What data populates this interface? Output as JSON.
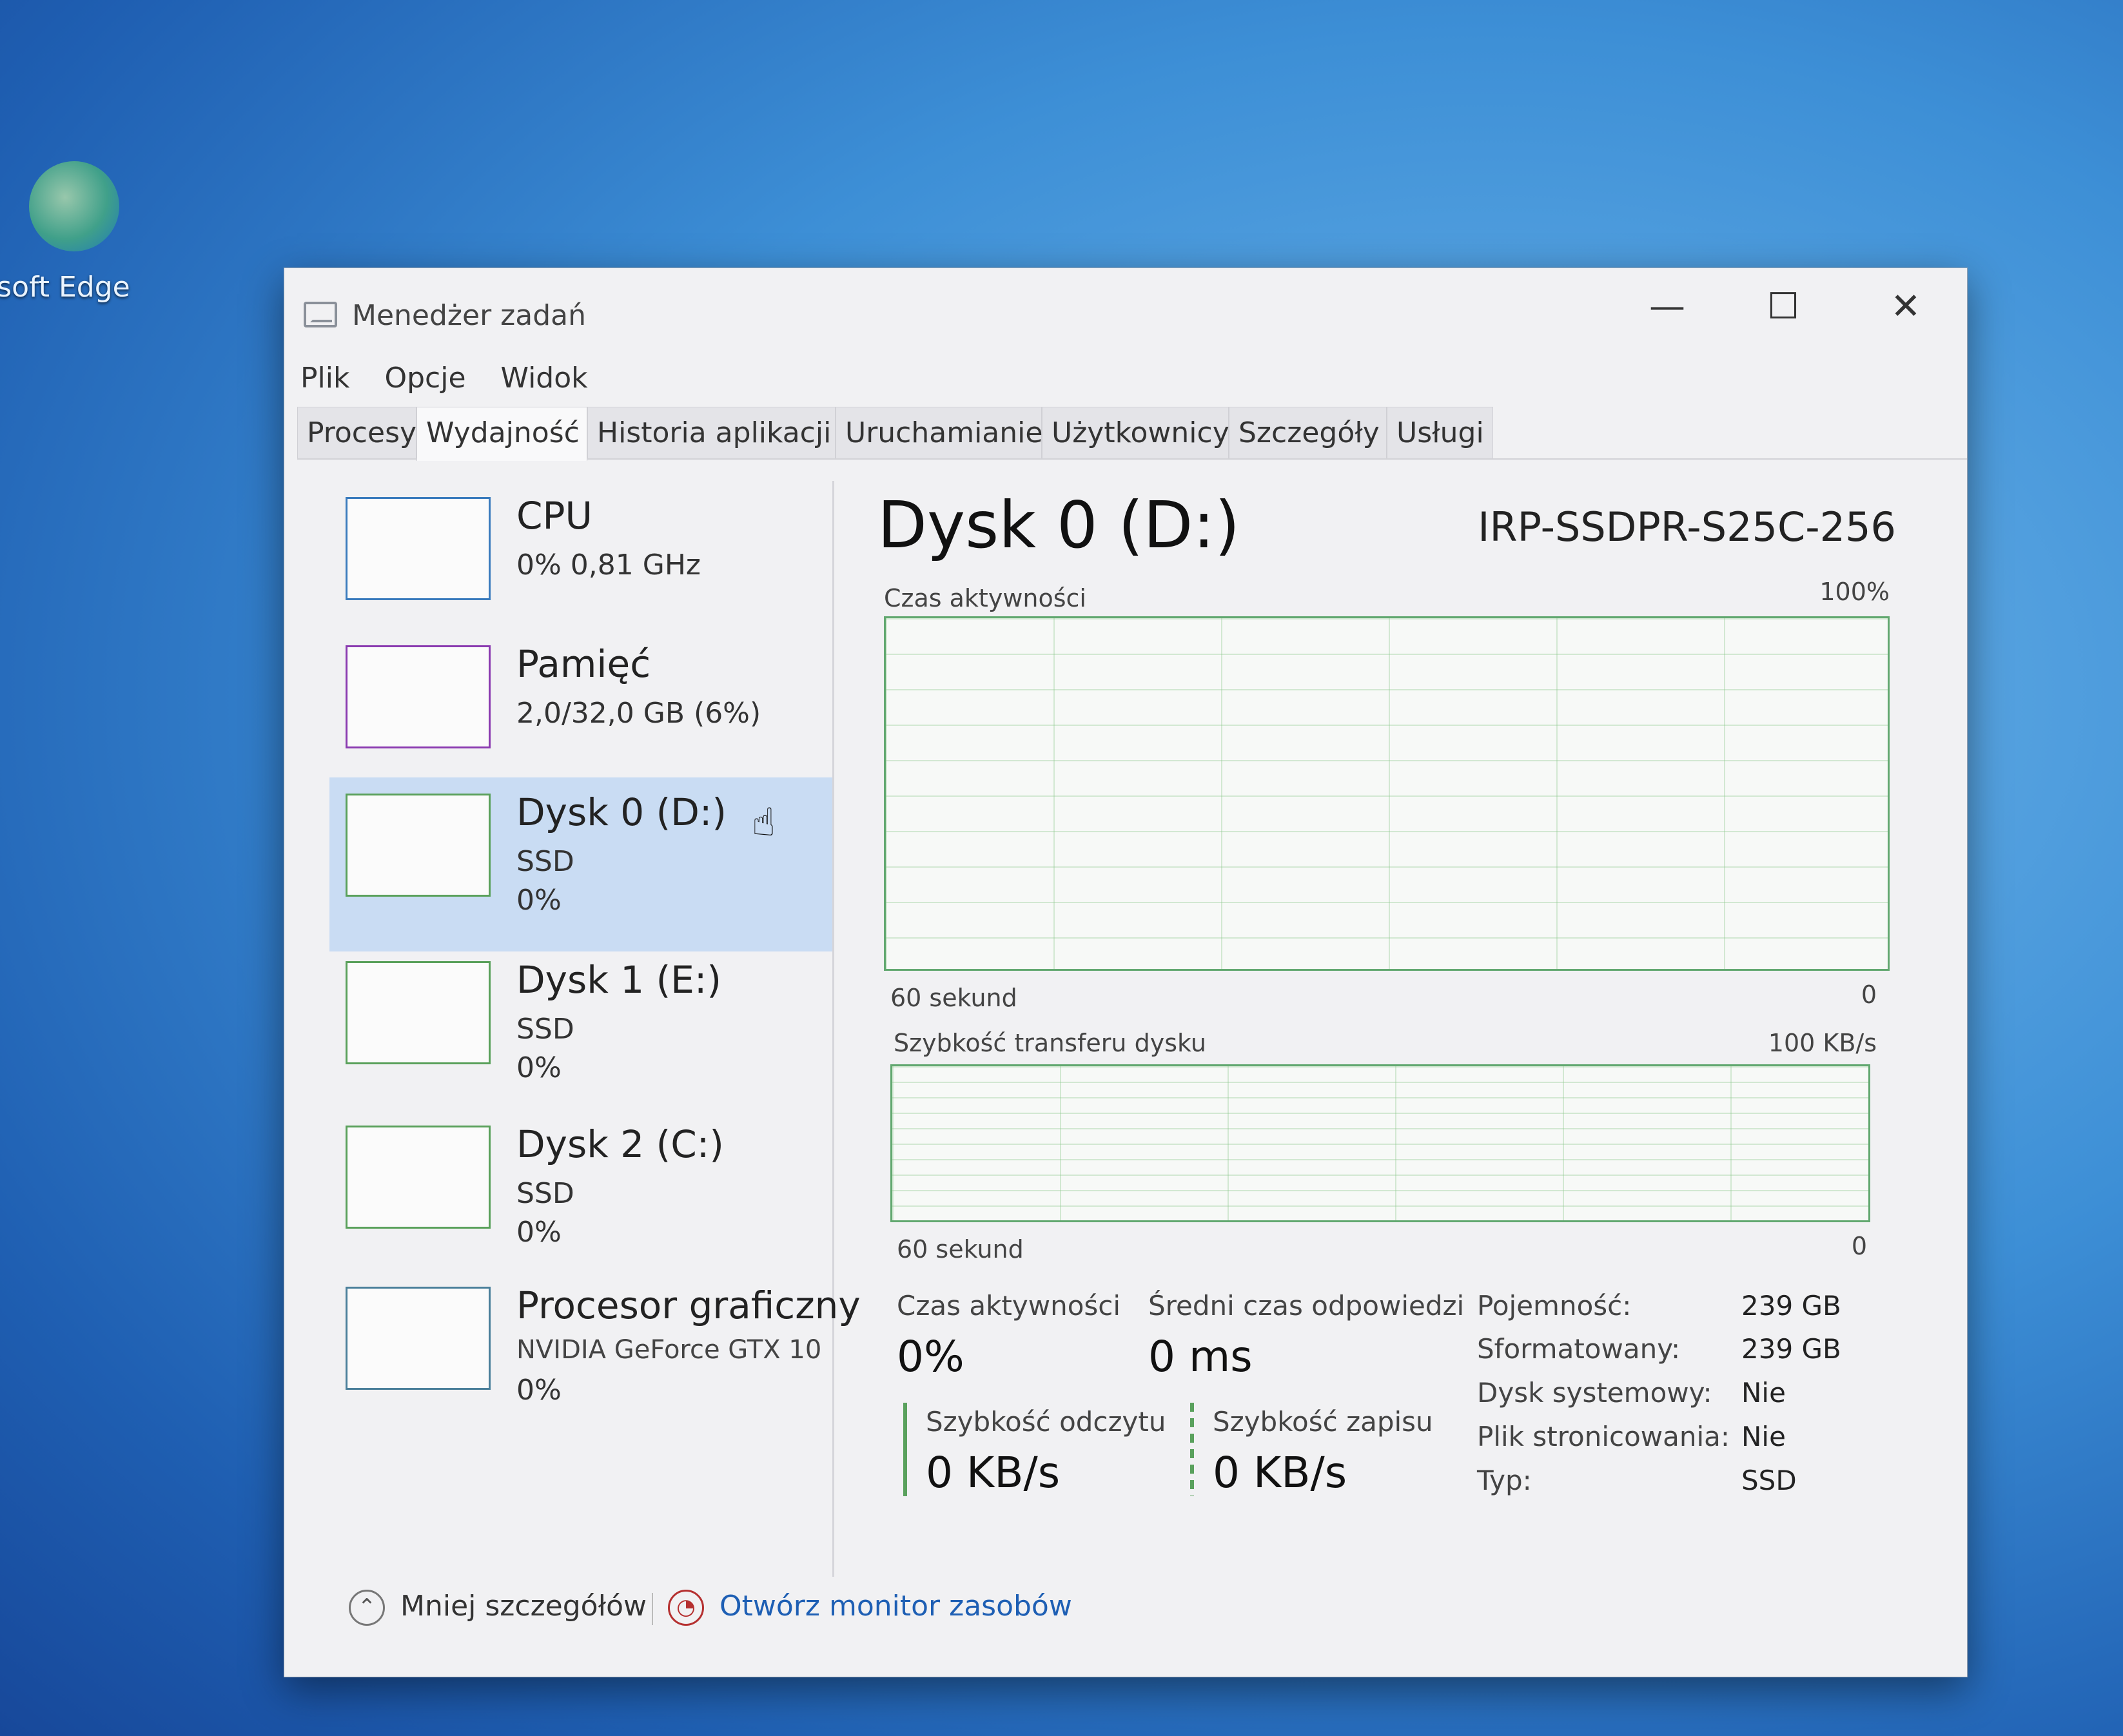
{
  "desktop": {
    "icon_label": "osoft Edge"
  },
  "window": {
    "title": "Menedżer zadań",
    "controls": {
      "minimize": "—",
      "maximize": "☐",
      "close": "✕"
    }
  },
  "menu": [
    "Plik",
    "Opcje",
    "Widok"
  ],
  "tabs": [
    "Procesy",
    "Wydajność",
    "Historia aplikacji",
    "Uruchamianie",
    "Użytkownicy",
    "Szczegóły",
    "Usługi"
  ],
  "active_tab": "Wydajność",
  "sidebar": {
    "items": [
      {
        "name": "CPU",
        "line1": "0% 0,81 GHz",
        "line2": ""
      },
      {
        "name": "Pamięć",
        "line1": "2,0/32,0 GB (6%)",
        "line2": ""
      },
      {
        "name": "Dysk 0 (D:)",
        "line1": "SSD",
        "line2": "0%"
      },
      {
        "name": "Dysk 1 (E:)",
        "line1": "SSD",
        "line2": "0%"
      },
      {
        "name": "Dysk 2 (C:)",
        "line1": "SSD",
        "line2": "0%"
      },
      {
        "name": "Procesor graficzny",
        "line1": "NVIDIA GeForce GTX 10",
        "line2": "0%"
      }
    ],
    "selected_index": 2
  },
  "detail": {
    "title": "Dysk 0 (D:)",
    "model": "IRP-SSDPR-S25C-256",
    "graph1": {
      "label": "Czas aktywności",
      "max": "100%",
      "time": "60 sekund",
      "min": "0"
    },
    "graph2": {
      "label": "Szybkość transferu dysku",
      "max": "100 KB/s",
      "time": "60 sekund",
      "min": "0"
    },
    "stats": {
      "active_label": "Czas aktywności",
      "active_value": "0%",
      "response_label": "Średni czas odpowiedzi",
      "response_value": "0 ms",
      "read_label": "Szybkość odczytu",
      "read_value": "0 KB/s",
      "write_label": "Szybkość zapisu",
      "write_value": "0 KB/s"
    },
    "properties": [
      {
        "label": "Pojemność:",
        "value": "239 GB"
      },
      {
        "label": "Sformatowany:",
        "value": "239 GB"
      },
      {
        "label": "Dysk systemowy:",
        "value": "Nie"
      },
      {
        "label": "Plik stronicowania:",
        "value": "Nie"
      },
      {
        "label": "Typ:",
        "value": "SSD"
      }
    ]
  },
  "footer": {
    "less_details": "Mniej szczegółów",
    "open_monitor": "Otwórz monitor zasobów"
  },
  "colors": {
    "graph_border": "#62a870",
    "selected_item": "#c9dcf3",
    "link": "#1e5fb4"
  }
}
